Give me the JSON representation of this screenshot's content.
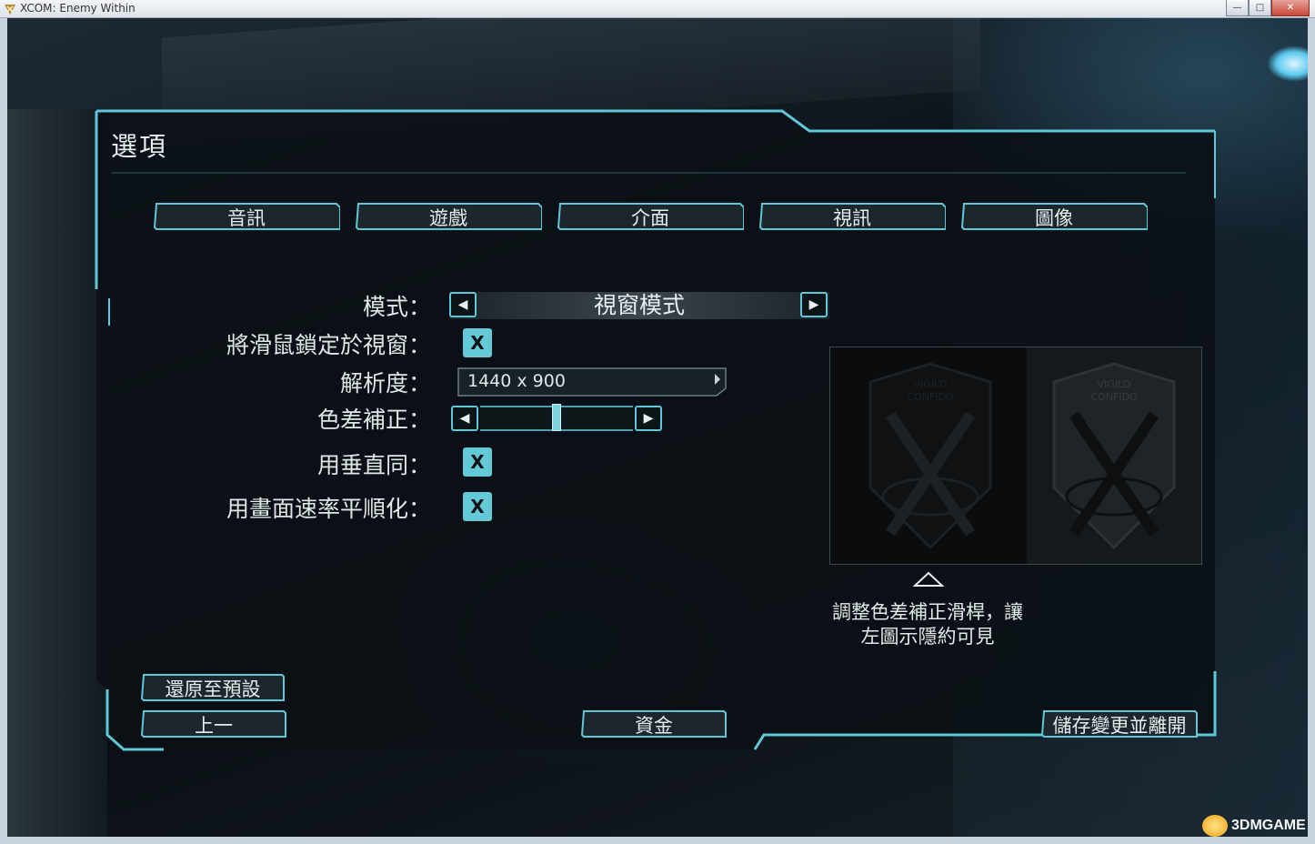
{
  "window": {
    "title": "XCOM: Enemy Within",
    "minimize": "—",
    "maximize": "□",
    "close": "✕"
  },
  "panel": {
    "title": "選項"
  },
  "tabs": [
    {
      "label": "音訊"
    },
    {
      "label": "遊戲"
    },
    {
      "label": "介面"
    },
    {
      "label": "視訊"
    },
    {
      "label": "圖像"
    }
  ],
  "settings": {
    "mode_label": "模式：",
    "mode_value": "視窗模式",
    "lock_mouse_label": "將滑鼠鎖定於視窗：",
    "lock_mouse_checked": "X",
    "resolution_label": "解析度：",
    "resolution_value": "1440 x 900",
    "gamma_label": "色差補正：",
    "gamma_level": 0.5,
    "vsync_label": "用垂直同：",
    "vsync_checked": "X",
    "smooth_label": "用畫面速率平順化：",
    "smooth_checked": "X"
  },
  "preview": {
    "emblem_text_top": "VIGILO",
    "emblem_text_bottom": "CONFIDO",
    "caption_line1": "調整色差補正滑桿，讓",
    "caption_line2": "左圖示隱約可見"
  },
  "buttons": {
    "restore_defaults": "還原至預設",
    "back": "上一",
    "credits": "資金",
    "save_exit": "儲存變更並離開"
  },
  "watermark": {
    "text": "3DMGAME"
  },
  "colors": {
    "accent": "#5ec7d8",
    "panel_bg": "#0c1114"
  }
}
